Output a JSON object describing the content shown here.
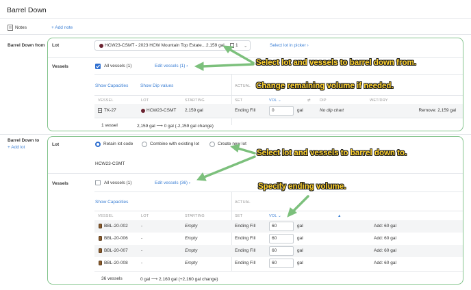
{
  "page_title": "Barrel Down",
  "notes": {
    "label": "Notes",
    "add_link": "+ Add note"
  },
  "from": {
    "section_label": "Barrel Down from",
    "lot_label": "Lot",
    "lot_value": "HCW23-CSMT - 2023 HCW Mountain Top Estate...",
    "lot_volume": "2,159 gal",
    "lot_count": "1",
    "picker_link": "Select lot in picker",
    "vessels_label": "Vessels",
    "all_vessels": "All vessels (1)",
    "edit_vessels": "Edit vessels (1)",
    "show_capacities": "Show Capacities",
    "show_dip": "Show Dip values",
    "actual": "ACTUAL",
    "headers": [
      "VESSEL",
      "LOT",
      "STARTING",
      "SET",
      "VOL",
      "DIP",
      "WET/DRY"
    ],
    "row": {
      "vessel": "TK-27",
      "lot": "HCW23-CSMT",
      "starting": "2,159 gal",
      "set": "Ending Fill",
      "vol": "0",
      "unit": "gal",
      "dip": "No dip chart",
      "remove": "Remove: 2,159 gal"
    },
    "footer_count": "1 vessel",
    "footer_change_from": "2,159 gal",
    "footer_change_to": "0 gal (-2,159 gal change)"
  },
  "to": {
    "section_label": "Barrel Down to",
    "add_lot": "+ Add lot",
    "lot_label": "Lot",
    "options": [
      "Retain lot code",
      "Combine with existing lot",
      "Create new lot"
    ],
    "lot_code": "HCW23-CSMT",
    "vessels_label": "Vessels",
    "all_vessels": "All vessels (1)",
    "edit_vessels": "Edit vessels (36)",
    "show_capacities": "Show Capacities",
    "actual": "ACTUAL",
    "headers": [
      "VESSEL",
      "LOT",
      "STARTING",
      "SET",
      "VOL"
    ],
    "rows": [
      {
        "vessel": "BBL-20-002",
        "lot": "-",
        "starting": "Empty",
        "set": "Ending Fill",
        "vol": "60",
        "unit": "gal",
        "add": "Add: 60 gal"
      },
      {
        "vessel": "BBL-20-006",
        "lot": "-",
        "starting": "Empty",
        "set": "Ending Fill",
        "vol": "60",
        "unit": "gal",
        "add": "Add: 60 gal"
      },
      {
        "vessel": "BBL-20-007",
        "lot": "-",
        "starting": "Empty",
        "set": "Ending Fill",
        "vol": "60",
        "unit": "gal",
        "add": "Add: 60 gal"
      },
      {
        "vessel": "BBL-20-008",
        "lot": "-",
        "starting": "Empty",
        "set": "Ending Fill",
        "vol": "60",
        "unit": "gal",
        "add": "Add: 60 gal"
      }
    ],
    "footer_count": "36 vessels",
    "footer_change_from": "0 gal",
    "footer_change_to": "2,160 gal (+2,160 gal change)"
  },
  "annotations": {
    "a1": "Select lot and vessels to barrel down from.",
    "a2": "Change remaining volume if needed.",
    "a3": "Select lot and vessels to barrel down to.",
    "a4": "Specify ending volume."
  },
  "colors": {
    "link": "#3b7fd4",
    "annotation": "#ffd22e",
    "highlight_box": "#82c38b",
    "checkbox": "#2f6fd0"
  }
}
